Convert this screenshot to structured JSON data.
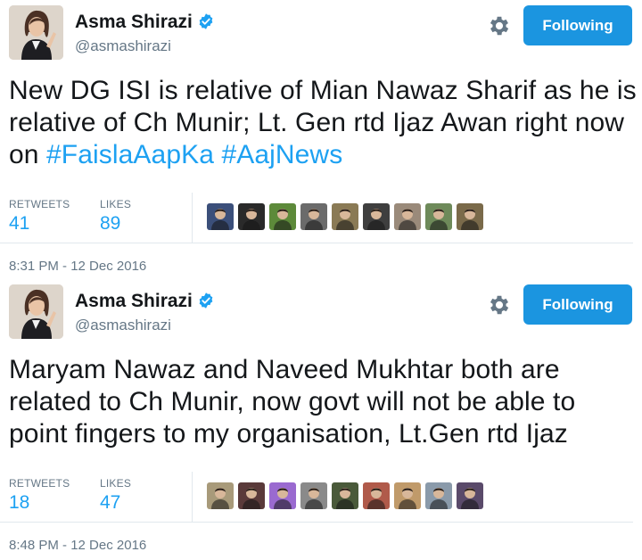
{
  "tweets": [
    {
      "author": {
        "name": "Asma Shirazi",
        "handle": "@asmashirazi",
        "verified": true
      },
      "follow_label": "Following",
      "text_segments": [
        {
          "text": "New DG ISI is relative of Mian Nawaz Sharif as he is relative of Ch Munir; Lt. Gen rtd Ijaz Awan right now on ",
          "hashtag": false
        },
        {
          "text": "#FaislaAapKa",
          "hashtag": true
        },
        {
          "text": " ",
          "hashtag": false
        },
        {
          "text": "#AajNews",
          "hashtag": true
        }
      ],
      "retweets_label": "RETWEETS",
      "retweets": "41",
      "likes_label": "LIKES",
      "likes": "89",
      "liker_avatars": [
        "#3b4f7a",
        "#2a2a2a",
        "#5d8a3a",
        "#6b6b6b",
        "#8a7a55",
        "#3f3f3f",
        "#9a8a7a",
        "#6e8a5a",
        "#7a6a4a"
      ],
      "timestamp": "8:31 PM - 12 Dec 2016"
    },
    {
      "author": {
        "name": "Asma Shirazi",
        "handle": "@asmashirazi",
        "verified": true
      },
      "follow_label": "Following",
      "text_segments": [
        {
          "text": "Maryam Nawaz and Naveed Mukhtar both are related to Ch Munir, now govt will not be able to point fingers to my organisation, Lt.Gen rtd Ijaz",
          "hashtag": false
        }
      ],
      "retweets_label": "RETWEETS",
      "retweets": "18",
      "likes_label": "LIKES",
      "likes": "47",
      "liker_avatars": [
        "#a89a7a",
        "#5a3a3a",
        "#9a6ad0",
        "#8a8a8a",
        "#4a5a3a",
        "#b05a4a",
        "#c09a6a",
        "#8a9aaa",
        "#5a4a6a"
      ],
      "timestamp": "8:48 PM - 12 Dec 2016"
    }
  ],
  "colors": {
    "accent": "#1da1f2",
    "follow_button": "#1b95e0",
    "muted": "#657786",
    "text": "#14171a"
  },
  "icons": {
    "verified": "verified-badge-icon",
    "settings": "gear-icon"
  }
}
